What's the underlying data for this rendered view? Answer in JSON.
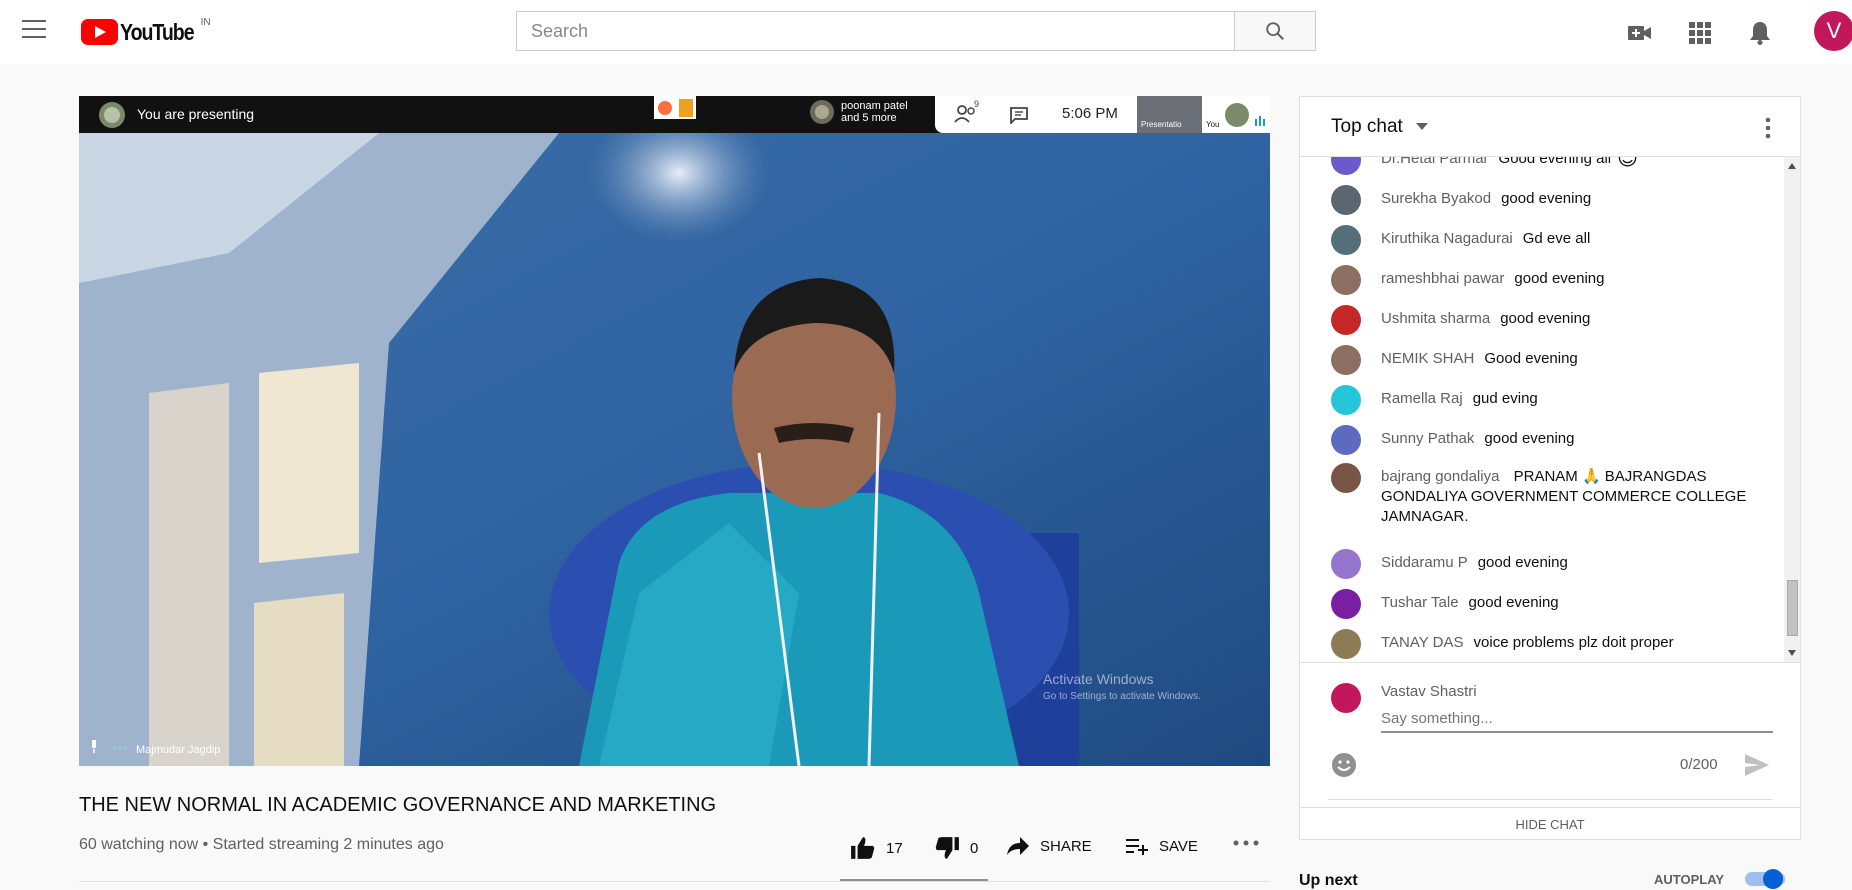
{
  "header": {
    "logo_text": "YouTube",
    "country": "IN",
    "search_placeholder": "Search",
    "user_initial": "V"
  },
  "player": {
    "presenting_label": "You are presenting",
    "participants_line1": "poonam patel",
    "participants_line2": "and 5 more",
    "participant_count": "9",
    "time": "5:06  PM",
    "presentation_label": "Presentatio",
    "you_label": "You",
    "speaker_name": "Majmudar Jagdip",
    "watermark_line1": "Activate Windows",
    "watermark_line2": "Go to Settings to activate Windows."
  },
  "video": {
    "title": "THE NEW NORMAL IN ACADEMIC GOVERNANCE AND MARKETING",
    "meta": "60 watching now • Started streaming 2 minutes ago",
    "likes": "17",
    "dislikes": "0",
    "share_label": "SHARE",
    "save_label": "SAVE"
  },
  "chat": {
    "header": "Top chat",
    "messages": [
      {
        "author": "Dr.Hetal Parmar",
        "text": "Good evening all",
        "color": "#6a5acd",
        "emoji": "😊"
      },
      {
        "author": "Surekha Byakod",
        "text": "good evening",
        "color": "#5b6770"
      },
      {
        "author": "Kiruthika Nagadurai",
        "text": "Gd eve all",
        "color": "#546e7a"
      },
      {
        "author": "rameshbhai pawar",
        "text": "good evening",
        "color": "#8d6e63"
      },
      {
        "author": "Ushmita sharma",
        "text": "good evening",
        "color": "#c62828"
      },
      {
        "author": "NEMIK SHAH",
        "text": "Good evening",
        "color": "#8d6e63"
      },
      {
        "author": "Ramella Raj",
        "text": "gud eving",
        "color": "#26c6da"
      },
      {
        "author": "Sunny Pathak",
        "text": "good evening",
        "color": "#5c6bc0"
      },
      {
        "author": "bajrang gondaliya",
        "text": "PRANAM 🙏 BAJRANGDAS GONDALIYA GOVERNMENT COMMERCE COLLEGE JAMNAGAR.",
        "color": "#795548"
      },
      {
        "author": "Siddaramu P",
        "text": "good evening",
        "color": "#9575cd"
      },
      {
        "author": "Tushar Tale",
        "text": "good evening",
        "color": "#7b1fa2"
      },
      {
        "author": "TANAY DAS",
        "text": "voice problems plz doit proper",
        "color": "#8d7b55"
      }
    ],
    "composer_name": "Vastav Shastri",
    "composer_placeholder": "Say something...",
    "char_count": "0/200",
    "hide_label": "HIDE CHAT"
  },
  "sidebar": {
    "up_next": "Up next",
    "autoplay": "AUTOPLAY"
  },
  "colors": {
    "brand_red": "#ff0000",
    "accent_blue": "#065fd4",
    "user_avatar": "#c2185b"
  }
}
